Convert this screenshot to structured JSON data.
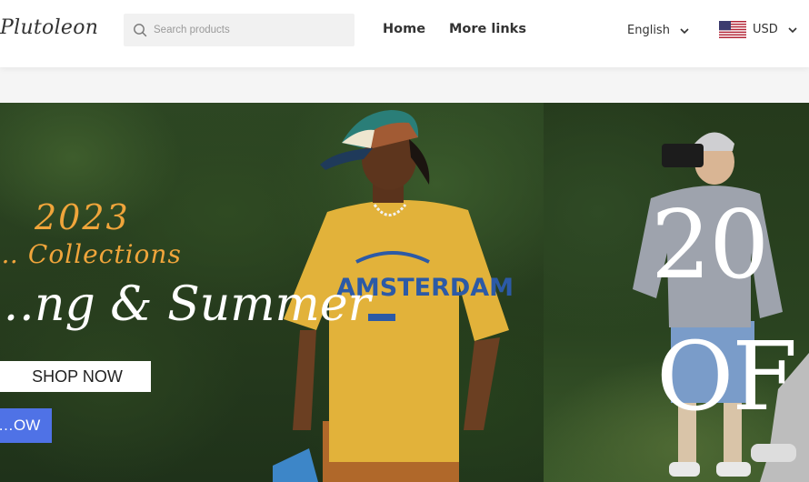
{
  "header": {
    "logo": "Plutoleon",
    "search": {
      "placeholder": "Search products",
      "value": "",
      "icon": "search-icon"
    },
    "nav": [
      {
        "label": "Home"
      },
      {
        "label": "More links"
      }
    ],
    "language": {
      "label": "English",
      "icon": "chevron-down-icon"
    },
    "currency": {
      "label": "USD",
      "flag": "us-flag-icon",
      "icon": "chevron-down-icon"
    }
  },
  "hero": {
    "slide1": {
      "year": "2023",
      "collections": "… Collections",
      "season": "…ng & Summer",
      "primary_button": "SHOP NOW",
      "secondary_button": "…OW",
      "shirt_text": "AMSTERDAM"
    },
    "slide2": {
      "headline_line1": "20",
      "headline_line2": "OF"
    }
  },
  "colors": {
    "accent_blue": "#4f72e6",
    "script_orange": "#f0a53b",
    "text_dark": "#333333"
  }
}
